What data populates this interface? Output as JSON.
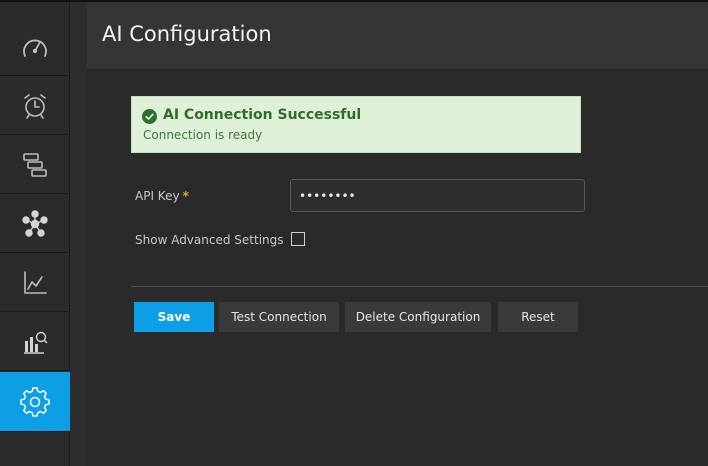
{
  "header": {
    "title": "AI Configuration"
  },
  "sidebar": {
    "items": [
      {
        "icon": "speedometer-icon"
      },
      {
        "icon": "alarm-clock-icon"
      },
      {
        "icon": "layers-icon"
      },
      {
        "icon": "network-nodes-icon"
      },
      {
        "icon": "line-chart-icon"
      },
      {
        "icon": "bar-chart-search-icon"
      },
      {
        "icon": "gear-icon",
        "active": true
      }
    ]
  },
  "alert": {
    "title": "AI Connection Successful",
    "message": "Connection is ready",
    "icon": "check-circle-icon",
    "color": "#2f6e2a"
  },
  "form": {
    "api_key_label": "API Key",
    "api_key_required_marker": "*",
    "api_key_value": "••••••••",
    "advanced_label": "Show Advanced Settings",
    "advanced_checked": false
  },
  "buttons": {
    "save": "Save",
    "test": "Test Connection",
    "delete": "Delete Configuration",
    "reset": "Reset"
  },
  "colors": {
    "accent": "#0d9fe6",
    "success_bg": "#dff0d8",
    "required": "#e6a83a"
  }
}
